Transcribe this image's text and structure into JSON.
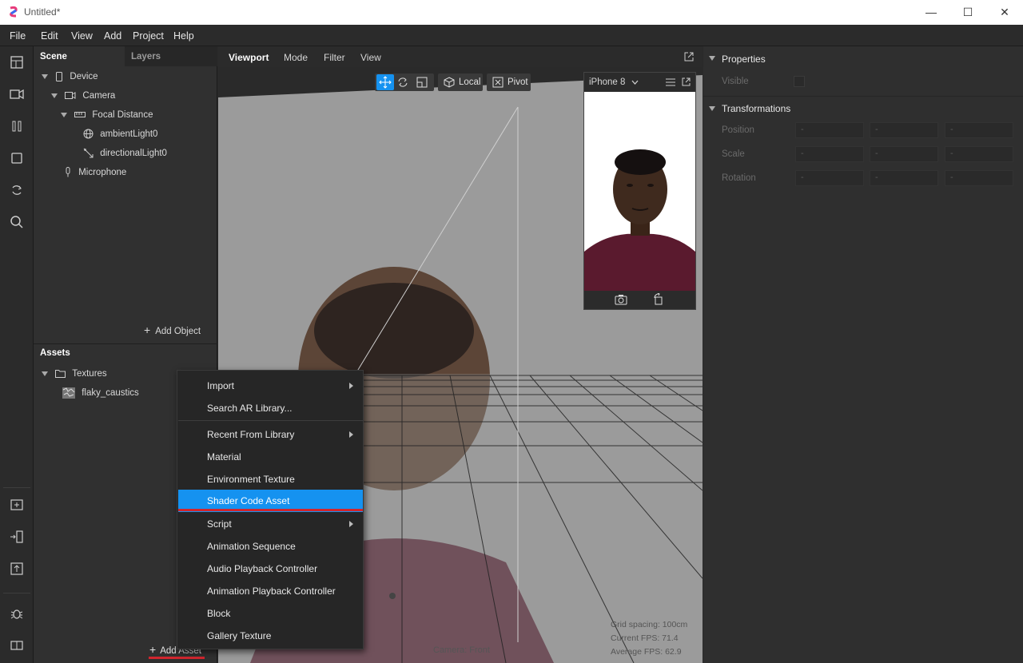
{
  "window": {
    "title": "Untitled*",
    "minimize": "—",
    "maximize": "☐",
    "close": "✕"
  },
  "menu": [
    "File",
    "Edit",
    "View",
    "Add",
    "Project",
    "Help"
  ],
  "left_tabs": {
    "scene": "Scene",
    "layers": "Layers"
  },
  "scene_tree": [
    {
      "label": "Device",
      "icon": "phone-icon"
    },
    {
      "label": "Camera",
      "icon": "camera-icon"
    },
    {
      "label": "Focal Distance",
      "icon": "focal-distance-icon"
    },
    {
      "label": "ambientLight0",
      "icon": "globe-icon"
    },
    {
      "label": "directionalLight0",
      "icon": "light-icon"
    },
    {
      "label": "Microphone",
      "icon": "microphone-icon"
    }
  ],
  "add_object": "Add Object",
  "assets": {
    "title": "Assets",
    "folder": "Textures",
    "item": "flaky_caustics",
    "add_label": "Add Asset"
  },
  "viewport": {
    "tabs": [
      "Viewport",
      "Mode",
      "Filter",
      "View"
    ],
    "local": "Local",
    "pivot": "Pivot",
    "device": "iPhone 8",
    "camera_label": "Camera: Front",
    "stats": [
      "Grid spacing: 100cm",
      "Current FPS:  71.4",
      "Average FPS:  62.9"
    ]
  },
  "properties": {
    "title": "Properties",
    "visible": "Visible",
    "transformations": "Transformations",
    "rows": [
      "Position",
      "Scale",
      "Rotation"
    ]
  },
  "context_menu": [
    {
      "label": "Import",
      "submenu": true
    },
    {
      "label": "Search AR Library..."
    },
    {
      "label": "Recent From Library",
      "submenu": true
    },
    {
      "label": "Material"
    },
    {
      "label": "Environment Texture"
    },
    {
      "label": "Shader Code Asset",
      "selected": true
    },
    {
      "label": "Script",
      "submenu": true
    },
    {
      "label": "Animation Sequence"
    },
    {
      "label": "Audio Playback Controller"
    },
    {
      "label": "Animation Playback Controller"
    },
    {
      "label": "Block"
    },
    {
      "label": "Gallery Texture"
    }
  ],
  "colors": {
    "accent": "#1592f0",
    "highlight_underline": "#d1262e"
  }
}
